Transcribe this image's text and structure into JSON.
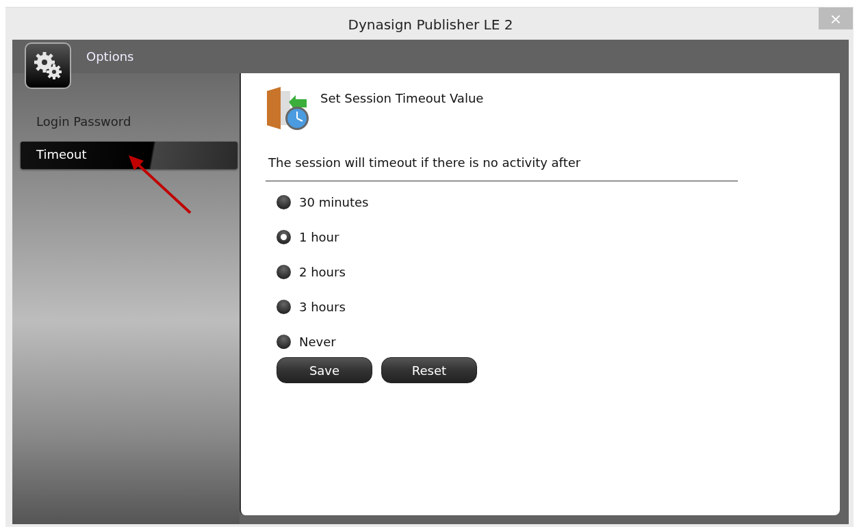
{
  "window": {
    "title": "Dynasign Publisher LE 2",
    "close": "×"
  },
  "header": {
    "title": "Options"
  },
  "sidebar": {
    "items": [
      {
        "label": "Login Password",
        "selected": false
      },
      {
        "label": "Timeout",
        "selected": true
      }
    ]
  },
  "panel": {
    "title": "Set Session Timeout Value",
    "description": "The session will timeout if there is no activity after",
    "options": [
      {
        "label": "30 minutes",
        "selected": false
      },
      {
        "label": "1 hour",
        "selected": true
      },
      {
        "label": "2 hours",
        "selected": false
      },
      {
        "label": "3 hours",
        "selected": false
      },
      {
        "label": "Never",
        "selected": false
      }
    ],
    "buttons": [
      "Save",
      "Reset"
    ]
  }
}
